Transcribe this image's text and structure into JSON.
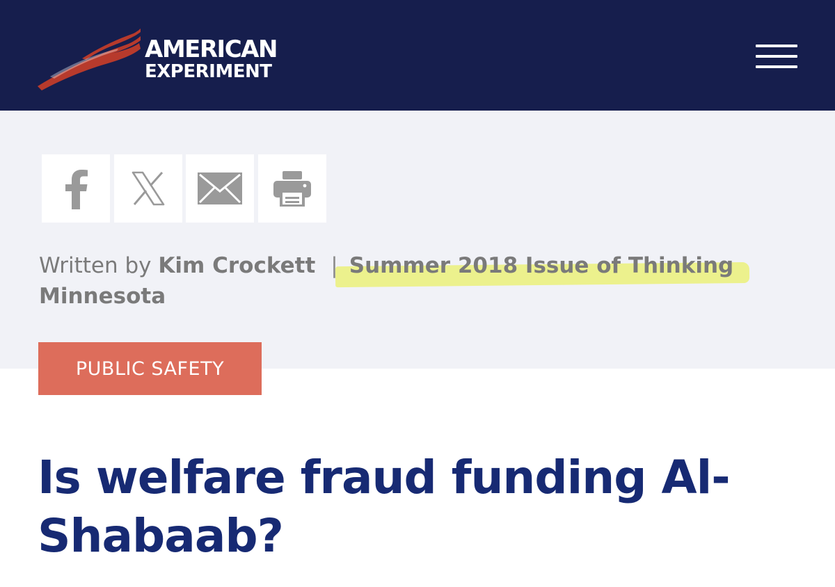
{
  "header": {
    "logo_line1": "AMERICAN",
    "logo_line2": "EXPERIMENT",
    "menu_icon": "hamburger-menu-icon",
    "background_color": "#161e4d",
    "logo_red": "#b73a2c"
  },
  "share_buttons": [
    {
      "icon": "facebook-icon"
    },
    {
      "icon": "x-icon"
    },
    {
      "icon": "email-icon"
    },
    {
      "icon": "print-icon"
    }
  ],
  "byline": {
    "written_by": "Written by",
    "author": "Kim Crockett",
    "separator": "|",
    "issue_prefix": "Summer 2018 Issue of Thinking",
    "issue_suffix": "Minnesota",
    "highlight_color": "#e9f046"
  },
  "article": {
    "category": "PUBLIC SAFETY",
    "category_color": "#dd6d5b",
    "title_line1": "Is welfare fraud funding Al-",
    "title_line2": "Shabaab?",
    "title_color": "#172a73"
  }
}
